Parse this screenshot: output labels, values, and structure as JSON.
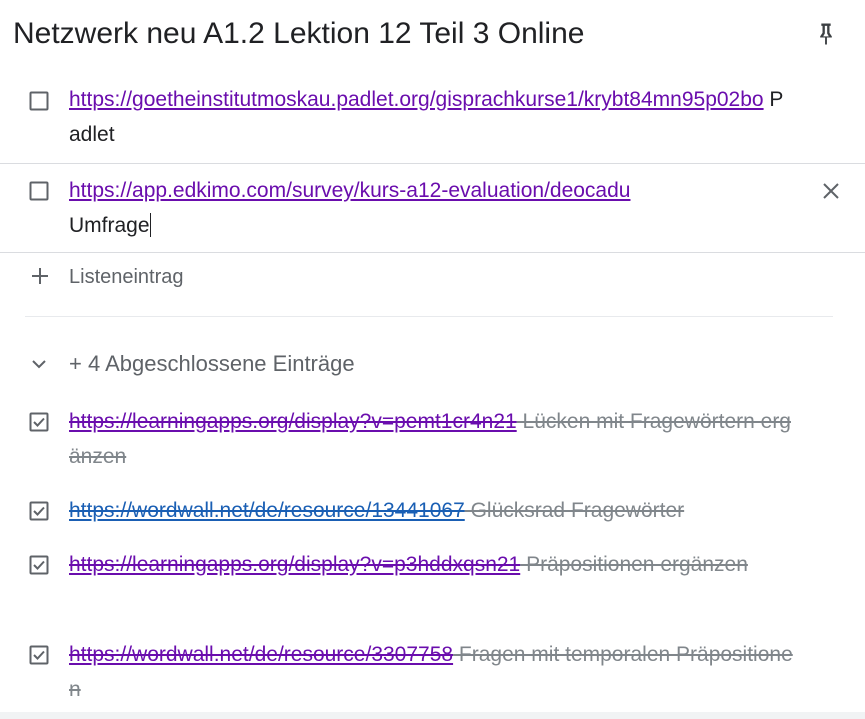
{
  "note": {
    "title": "Netzwerk neu A1.2 Lektion 12 Teil 3 Online"
  },
  "items": [
    {
      "checked": false,
      "link": "https://goetheinstitutmoskau.padlet.org/gisprachkurse1/krybt84mn95p02bo",
      "text": " Padlet"
    },
    {
      "checked": false,
      "link": "https://app.edkimo.com/survey/kurs-a12-evaluation/deocadu",
      "text": "Umfrage"
    }
  ],
  "add_item": {
    "label": "Listeneintrag"
  },
  "completed": {
    "label": "+ 4 Abgeschlossene Einträge",
    "items": [
      {
        "checked": true,
        "link": "https://learningapps.org/display?v=pemt1cr4n21",
        "text": " Lücken mit Fragewörtern ergänzen"
      },
      {
        "checked": true,
        "link": "https://wordwall.net/de/resource/13441067",
        "text": " Glücksrad Fragewörter"
      },
      {
        "checked": true,
        "link": "https://learningapps.org/display?v=p3hddxqsn21",
        "text": " Präpositionen ergänzen"
      },
      {
        "checked": true,
        "link": "https://wordwall.net/de/resource/3307758",
        "text": "  Fragen mit temporalen Präpositionen"
      }
    ]
  },
  "icons": {
    "pin": "pin-icon",
    "checkbox_empty": "checkbox-empty-icon",
    "checkbox_checked": "checkbox-checked-icon",
    "close": "close-icon",
    "plus": "plus-icon",
    "chevron": "chevron-down-icon"
  },
  "colors": {
    "link_visited": "#6a0dad",
    "link": "#1a5fb4",
    "done_text": "#80868b",
    "muted": "#5f6368"
  }
}
